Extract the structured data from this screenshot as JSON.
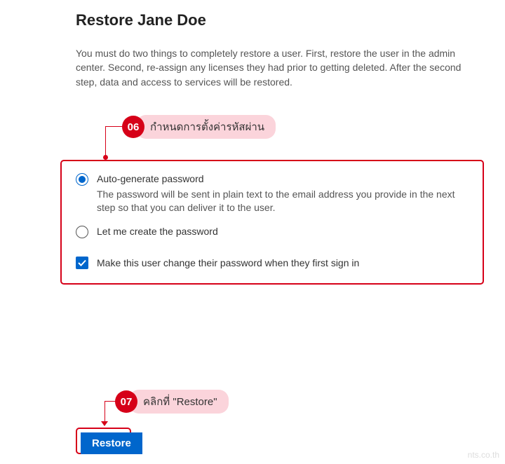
{
  "title": "Restore Jane Doe",
  "description": "You must do two things to completely restore a user. First, restore the user in the admin center. Second, re-assign any licenses they had prior to getting deleted. After the second step, data and access to services will be restored.",
  "callouts": {
    "step06": {
      "num": "06",
      "label": "กำหนดการตั้งค่ารหัสผ่าน"
    },
    "step07": {
      "num": "07",
      "label": "คลิกที่ \"Restore\""
    }
  },
  "options": {
    "auto": {
      "label": "Auto-generate password",
      "sub": "The password will be sent in plain text to the email address you provide in the next step so that you can deliver it to the user."
    },
    "manual": {
      "label": "Let me create the password"
    }
  },
  "checkbox_label": "Make this user change their password when they first sign in",
  "button": "Restore",
  "watermark": "nts.co.th"
}
